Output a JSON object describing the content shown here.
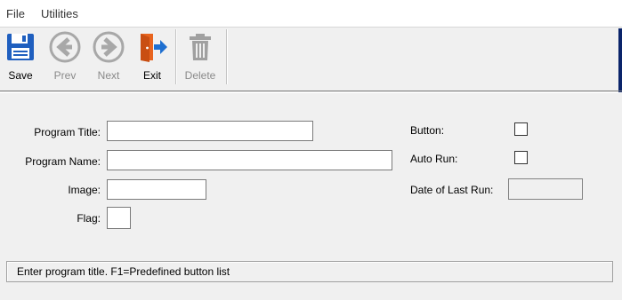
{
  "menu": {
    "file": "File",
    "utilities": "Utilities"
  },
  "toolbar": {
    "save": "Save",
    "prev": "Prev",
    "next": "Next",
    "exit": "Exit",
    "delete": "Delete"
  },
  "form": {
    "program_title": {
      "label": "Program Title:",
      "value": ""
    },
    "program_name": {
      "label": "Program Name:",
      "value": ""
    },
    "image": {
      "label": "Image:",
      "value": ""
    },
    "flag": {
      "label": "Flag:",
      "value": ""
    },
    "button": {
      "label": "Button:",
      "checked": false
    },
    "auto_run": {
      "label": "Auto Run:",
      "checked": false
    },
    "date_of_last_run": {
      "label": "Date of Last Run:",
      "value": ""
    }
  },
  "status": {
    "text": "Enter program title. F1=Predefined button list"
  },
  "colors": {
    "save_blue": "#1f5fbf",
    "nav_gray": "#a8a8a8",
    "exit_orange": "#e8641e",
    "exit_blue": "#1e6fd0",
    "delete_gray": "#a0a0a0"
  }
}
